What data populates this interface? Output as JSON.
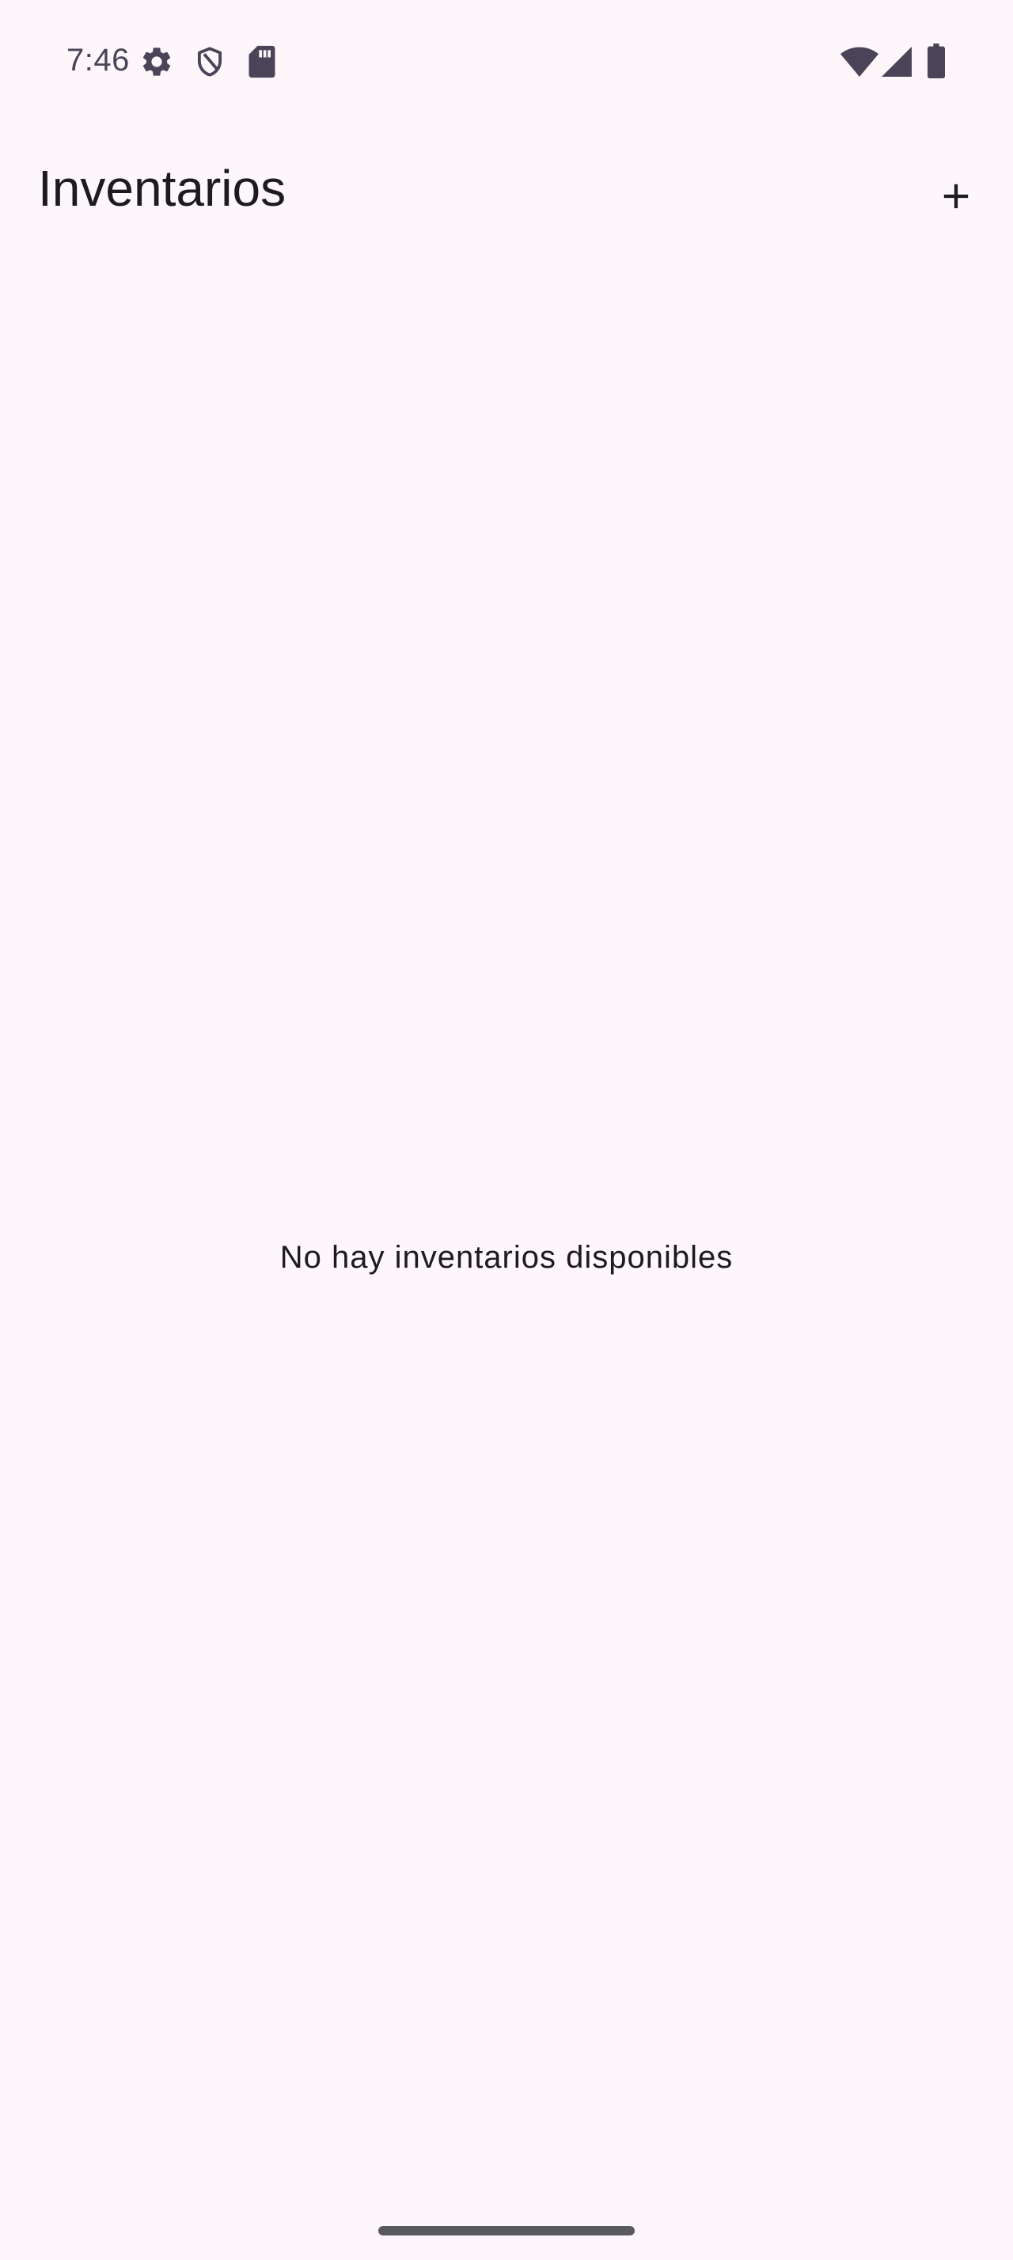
{
  "status_bar": {
    "time": "7:46",
    "left_icons": [
      "settings-icon",
      "shield-icon",
      "sd-card-icon"
    ],
    "right_icons": [
      "wifi-icon",
      "cell-signal-icon",
      "battery-icon"
    ]
  },
  "app_bar": {
    "title": "Inventarios",
    "action_icon": "plus-icon"
  },
  "main": {
    "empty_message": "No hay inventarios disponibles"
  },
  "colors": {
    "background": "#fdf7fc",
    "text_primary": "#1d1b20",
    "status_icons": "#4a4458",
    "gesture_handle": "#5b5960"
  }
}
